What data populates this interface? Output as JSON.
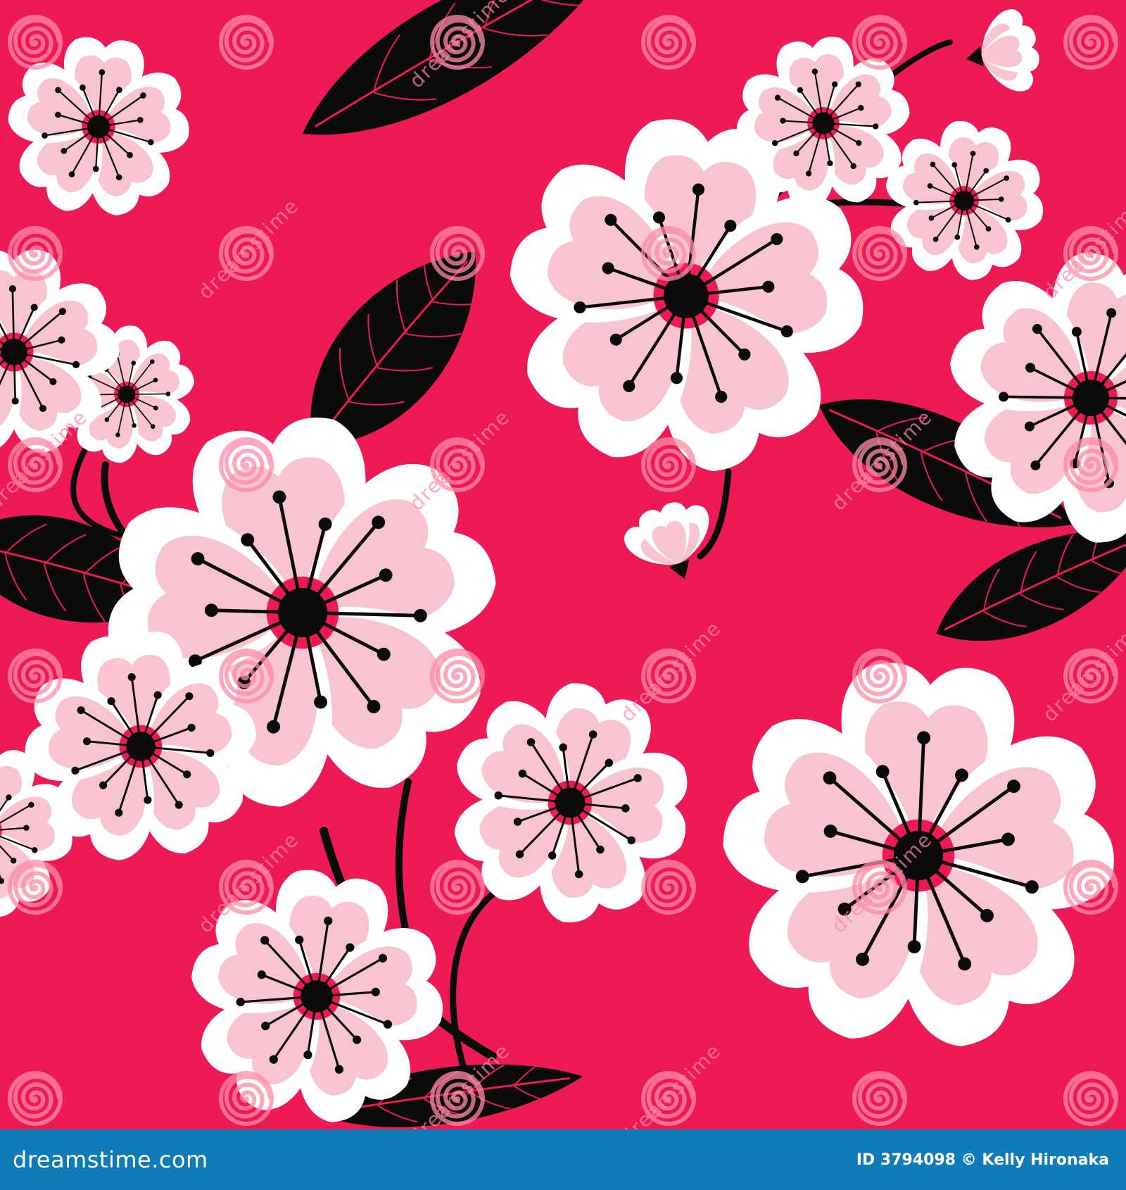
{
  "pattern": {
    "background_color": "#ee1a55",
    "petal_color": "#ffffff",
    "petal_blush_color": "#f9c4d2",
    "leaf_color": "#0a0a0a",
    "vein_color": "#ee1a55",
    "center_color": "#0a0a0a"
  },
  "watermark": {
    "text": "dreamstime",
    "mark_icon": "spiral-icon",
    "color": "#ff8aa8"
  },
  "footer": {
    "background_color": "#0f7bb8",
    "logo_text": "dreamstime.com",
    "image_id": "ID 3794098",
    "copyright_symbol": "©",
    "author": "Kelly Hironaka",
    "text_color": "#ffffff"
  }
}
